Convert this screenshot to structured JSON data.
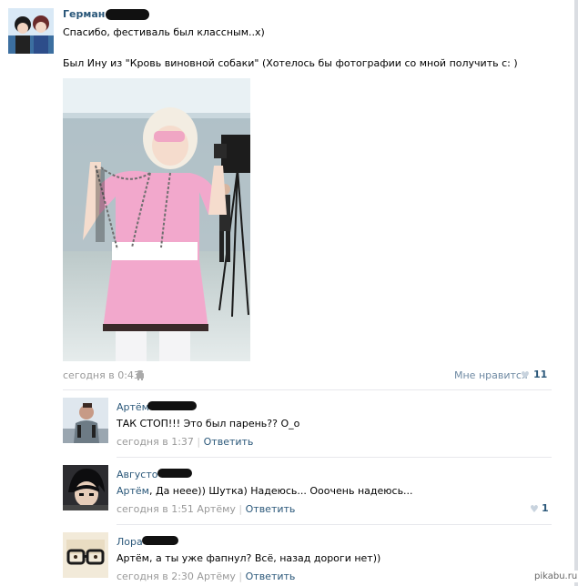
{
  "post": {
    "author": "Герман",
    "line1": "Спасибо, фестиваль был классным..х)",
    "line2": "Был Ину из \"Кровь виновной собаки\" (Хотелось бы фотографии со мной получить с: )",
    "time": "сегодня в 0:43",
    "like_label": "Мне нравится",
    "like_count": "11"
  },
  "comments": [
    {
      "author": "Артём",
      "text": "ТАК СТОП!!! Это был парень?? О_о",
      "time": "сегодня в 1:37",
      "sep": "|",
      "reply": "Ответить"
    },
    {
      "author": "Августо",
      "prefix": "Артём",
      "text": ", Да нееe)) Шутка) Надеюсь... Ооочень надеюсь...",
      "time": "сегодня в 1:51 Артёму",
      "sep": "|",
      "reply": "Ответить",
      "likes": "1"
    },
    {
      "author": "Лора",
      "text": "Артём, а ты уже фапнул? Всё, назад дороги нет))",
      "time": "сегодня в 2:30 Артёму",
      "sep": "|",
      "reply": "Ответить"
    }
  ],
  "watermark": "pikabu.ru",
  "colors": {
    "link": "#2b587a",
    "meta": "#999999",
    "separator": "#e7e8ec",
    "dress": "#f2a8cc"
  }
}
